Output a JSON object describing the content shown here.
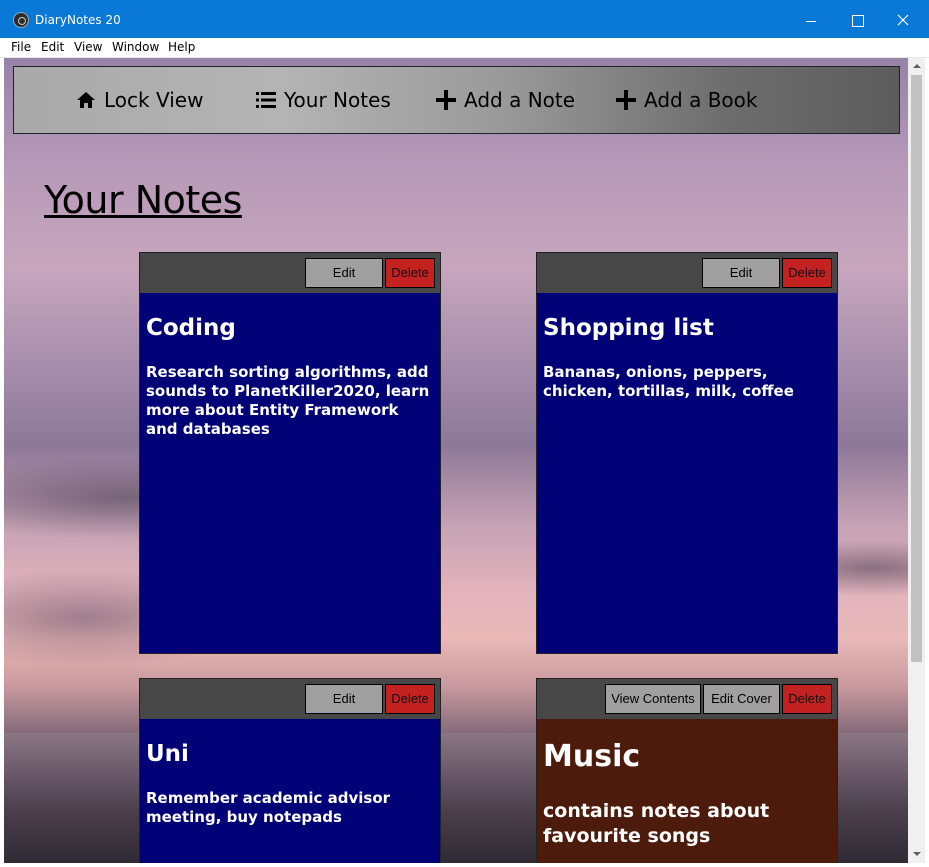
{
  "window": {
    "title": "DiaryNotes 20"
  },
  "menu": [
    "File",
    "Edit",
    "View",
    "Window",
    "Help"
  ],
  "nav": {
    "lock_view": "Lock View",
    "your_notes": "Your Notes",
    "add_note": "Add a Note",
    "add_book": "Add a Book"
  },
  "page": {
    "title": "Your Notes"
  },
  "notes": [
    {
      "title": "Coding",
      "body": "Research sorting algorithms, add sounds to PlanetKiller2020, learn more about Entity Framework and databases",
      "edit_label": "Edit",
      "delete_label": "Delete"
    },
    {
      "title": "Shopping list",
      "body": "Bananas, onions, peppers, chicken, tortillas, milk, coffee",
      "edit_label": "Edit",
      "delete_label": "Delete"
    },
    {
      "title": "Uni",
      "body": "Remember academic advisor meeting, buy notepads",
      "edit_label": "Edit",
      "delete_label": "Delete"
    }
  ],
  "book": {
    "title": "Music",
    "body": "contains notes about favourite songs",
    "view_label": "View Contents",
    "edit_cover_label": "Edit Cover",
    "delete_label": "Delete"
  },
  "colors": {
    "note_bg": "#000077",
    "book_bg": "#4d1b0c",
    "delete_btn": "#c42121",
    "titlebar": "#0a78d7"
  }
}
